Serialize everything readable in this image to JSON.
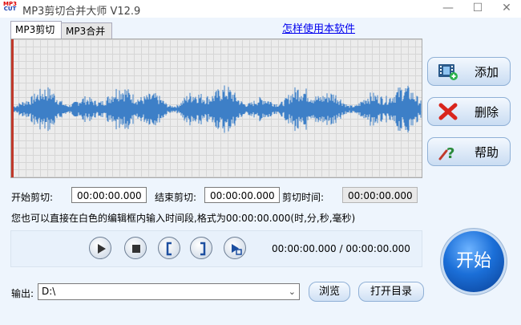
{
  "window": {
    "title": "MP3剪切合并大师 V12.9",
    "icon_lines": [
      "MP3",
      "CUT"
    ],
    "controls": [
      "minimize-icon",
      "maximize-icon",
      "close-icon"
    ]
  },
  "tabs": [
    {
      "label": "MP3剪切",
      "active": true
    },
    {
      "label": "MP3合并",
      "active": false
    }
  ],
  "help_link": "怎样使用本软件",
  "waveform": {
    "color": "#3d7fc7",
    "cursor_color": "#c0392b",
    "grid": true
  },
  "side_buttons": {
    "add": {
      "label": "添加",
      "icon": "film-add-icon"
    },
    "delete": {
      "label": "删除",
      "icon": "red-x-icon"
    },
    "help": {
      "label": "帮助",
      "icon": "question-icon"
    }
  },
  "times": {
    "start_label": "开始剪切:",
    "start_value": "00:00:00.000",
    "end_label": "结束剪切:",
    "end_value": "00:00:00.000",
    "duration_label": "剪切时间:",
    "duration_value": "00:00:00.000"
  },
  "hint": "您也可以直接在白色的编辑框内输入时间段,格式为00:00:00.000(时,分,秒,毫秒)",
  "playback": {
    "buttons": [
      "play-icon",
      "stop-icon",
      "set-start-bracket-icon",
      "set-end-bracket-icon",
      "play-selection-icon"
    ],
    "position": "00:00:00.000",
    "separator": "/",
    "total": "00:00:00.000"
  },
  "start_button": "开始",
  "output": {
    "label": "输出:",
    "path": "D:\\",
    "browse": "浏览",
    "open_dir": "打开目录"
  }
}
